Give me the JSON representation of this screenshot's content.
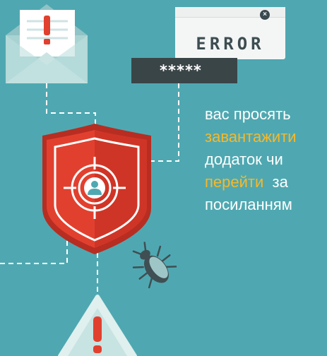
{
  "error_window": {
    "text": "ERROR",
    "close_glyph": "×"
  },
  "password_field": {
    "mask": "*****"
  },
  "message": {
    "line1": "вас просять",
    "line2_highlight": "завантажити",
    "line3": "додаток чи",
    "line4_highlight": "перейти",
    "line4_rest": "  за",
    "line5": "посиланням"
  },
  "icons": [
    "envelope-alert-icon",
    "lock-icon",
    "target-shield-icon",
    "user-icon",
    "bug-icon",
    "warning-triangle-icon"
  ],
  "colors": {
    "background": "#4fa8b1",
    "highlight": "#f6b82a",
    "shield_red": "#e2402f",
    "dark": "#3a4548"
  }
}
